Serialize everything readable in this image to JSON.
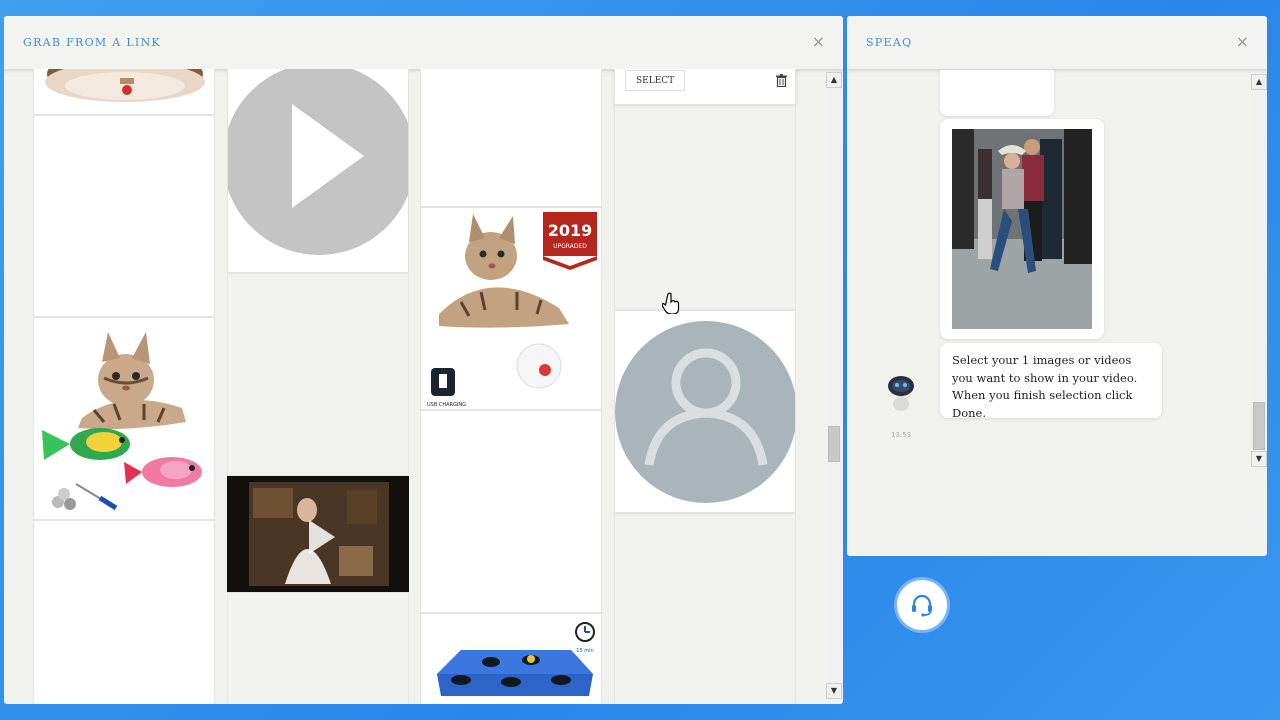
{
  "left_panel": {
    "title": "GRAB FROM A LINK",
    "close": "×",
    "select_button": "SELECT",
    "badge": {
      "year": "2019",
      "text": "UPGRADED"
    },
    "usb_text": "USB CHARGING",
    "timer_text": "15 min"
  },
  "right_panel": {
    "title": "SPEAQ",
    "close": "×",
    "bot_message": "Select your 1 images or videos you want to show in your video. When you finish selection click Done.",
    "bot_time": "13:53"
  },
  "icons": {
    "play": "play-icon",
    "avatar": "user-placeholder-icon",
    "trash": "trash-icon",
    "support": "headset-icon"
  },
  "colors": {
    "accent": "#3a8fd8",
    "background": "#2f8ded",
    "panel": "#f1f1ee",
    "badge": "#b5271c"
  }
}
